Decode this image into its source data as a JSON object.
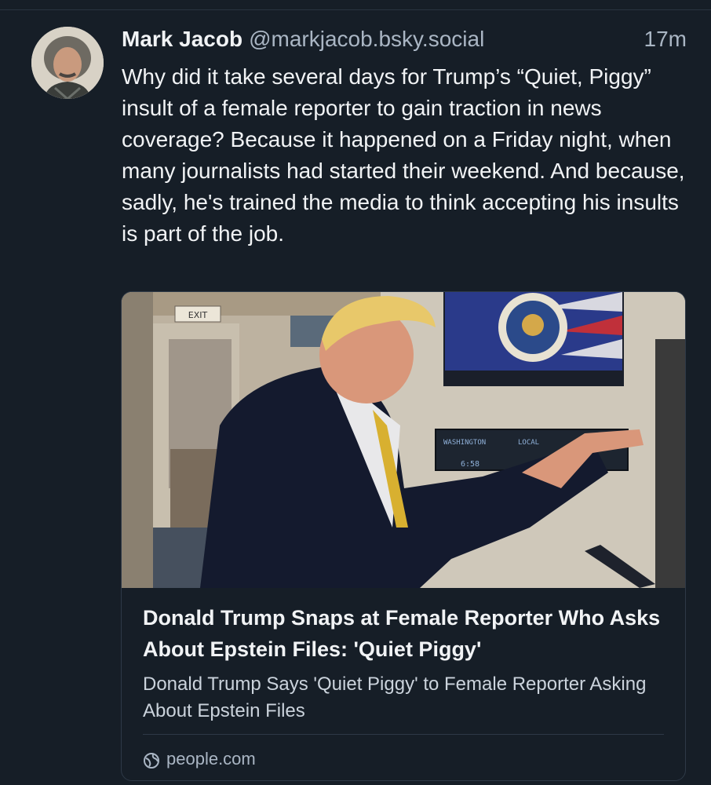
{
  "post": {
    "author_name": "Mark Jacob",
    "author_handle": "@markjacob.bsky.social",
    "timestamp": "17m",
    "text": "Why did it take several days for Trump’s “Quiet, Piggy” insult of a female reporter to gain traction in news coverage? Because it happened on a Friday night, when many journalists had started their weekend. And because, sadly, he's trained the media to think accepting his insults is part of the job."
  },
  "link_card": {
    "image_text": {
      "exit_sign": "EXIT",
      "clock_label_1": "WASHINGTON",
      "clock_label_2": "LOCAL",
      "clock_time": "6:58"
    },
    "title": "Donald Trump Snaps at Female Reporter Who Asks About Epstein Files: 'Quiet Piggy'",
    "description": "Donald Trump Says 'Quiet Piggy' to Female Reporter Asking About Epstein Files",
    "source": "people.com",
    "source_icon": "globe-icon"
  },
  "colors": {
    "background": "#161e27",
    "text_primary": "#f1f3f5",
    "text_secondary": "#aab6c4",
    "border": "#2e3947"
  }
}
